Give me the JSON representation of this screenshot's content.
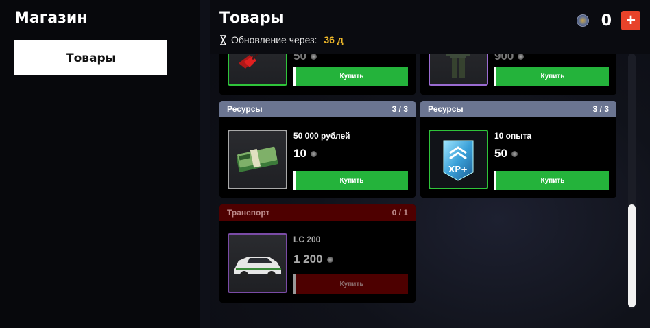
{
  "sidebar": {
    "title": "Магазин",
    "tabs": [
      {
        "label": "Товары"
      }
    ]
  },
  "header": {
    "title": "Товары",
    "update_label": "Обновление через:",
    "update_value": "36 д",
    "balance": "0",
    "add_button_label": "+"
  },
  "cards": [
    {
      "category": "",
      "count": "",
      "name": "",
      "price": "50",
      "buy_label": "Купить",
      "item": "guitar",
      "border_color": "#2fc43a",
      "available": true
    },
    {
      "category": "",
      "count": "",
      "name": "",
      "price": "900",
      "buy_label": "Купить",
      "item": "soldier",
      "border_color": "#9a6bd1",
      "available": true
    },
    {
      "category": "Ресурсы",
      "count": "3 / 3",
      "name": "50 000 рублей",
      "price": "10",
      "buy_label": "Купить",
      "item": "money",
      "border_color": "#a9a9a9",
      "available": true
    },
    {
      "category": "Ресурсы",
      "count": "3 / 3",
      "name": "10 опыта",
      "price": "50",
      "buy_label": "Купить",
      "item": "xp-badge",
      "border_color": "#2fc43a",
      "available": true
    },
    {
      "category": "Транспорт",
      "count": "0 / 1",
      "name": "LC 200",
      "price": "1 200",
      "buy_label": "Купить",
      "item": "car",
      "border_color": "#7a4ba6",
      "available": false
    }
  ],
  "scrollbar": {
    "position": 0.85
  },
  "colors": {
    "accent_green": "#24b33b",
    "accent_red": "#e8432a",
    "gold": "#f0b92a",
    "resource_header": "#6b7591",
    "transport_header": "#4e0000"
  }
}
